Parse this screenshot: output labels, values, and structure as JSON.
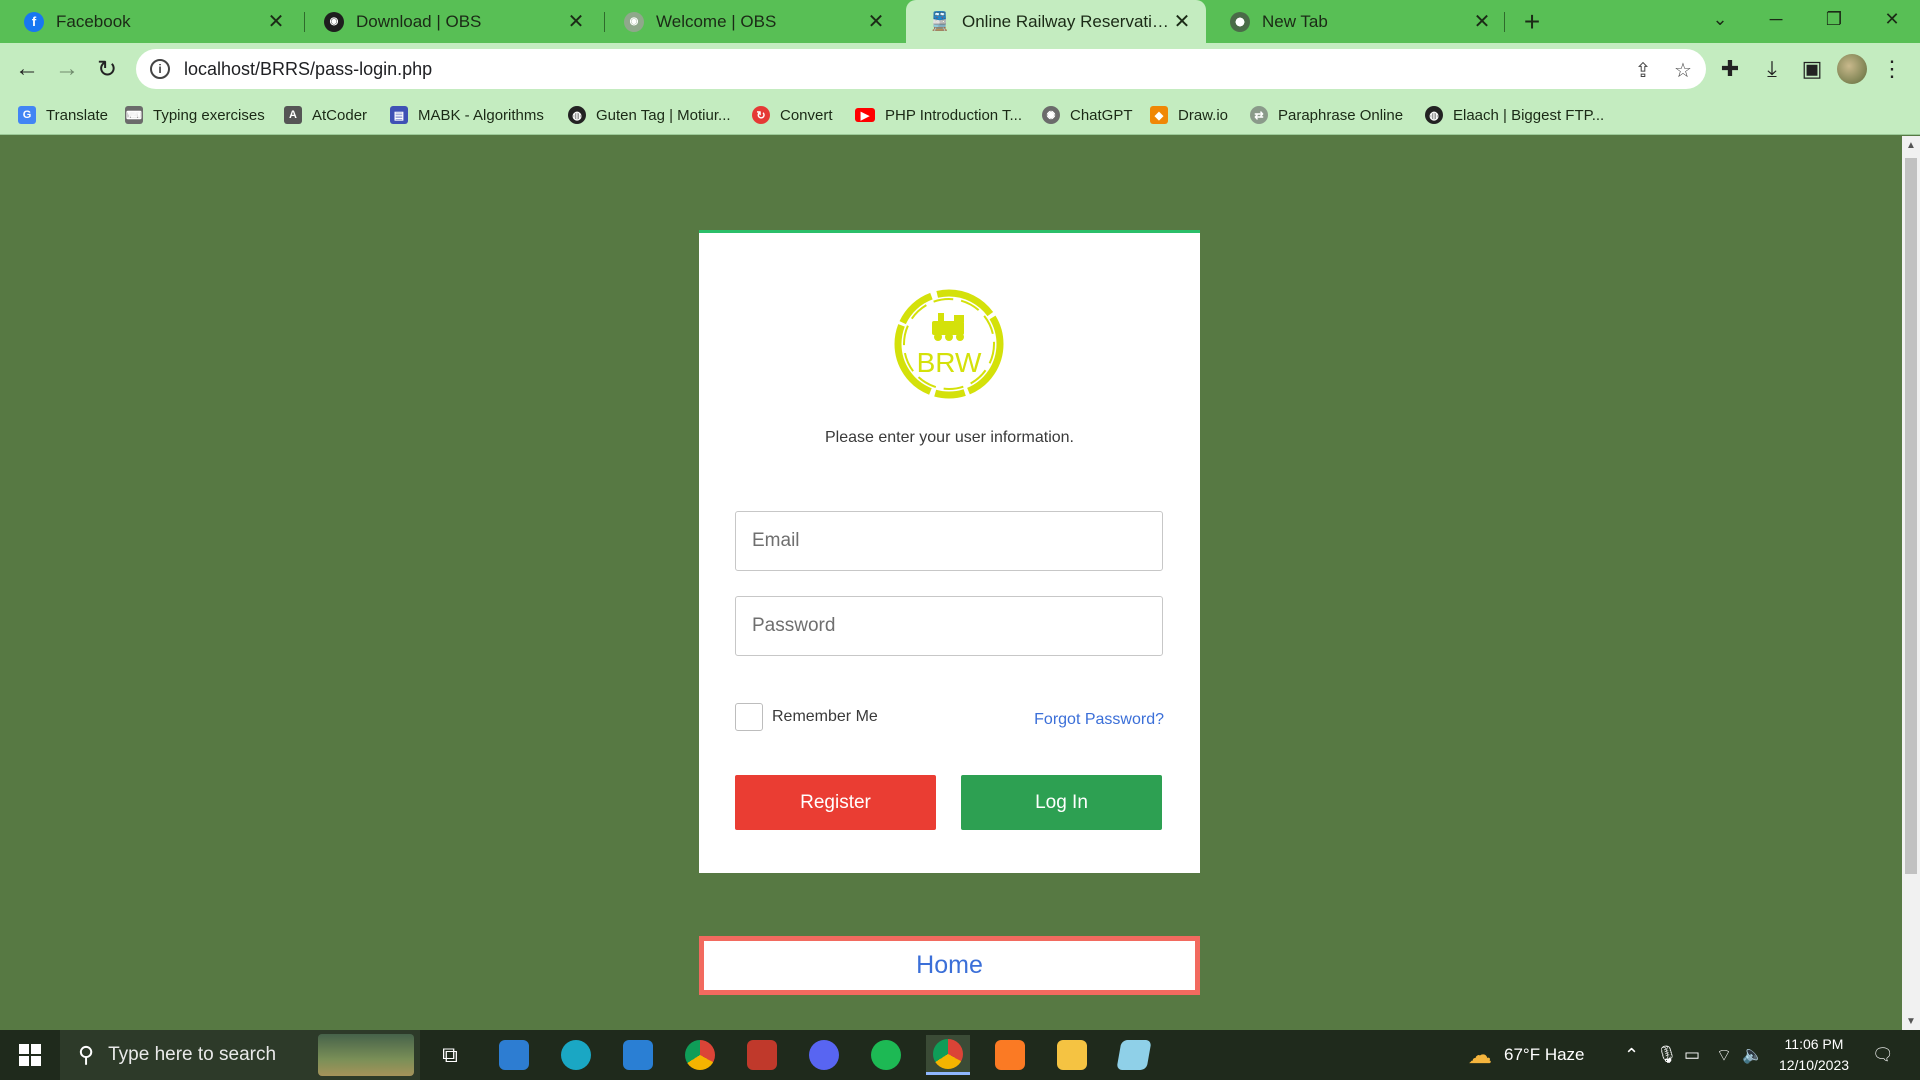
{
  "tabs": [
    {
      "title": "Facebook",
      "icon": "facebook-icon"
    },
    {
      "title": "Download | OBS",
      "icon": "obs-icon"
    },
    {
      "title": "Welcome | OBS",
      "icon": "obs-icon"
    },
    {
      "title": "Online Railway Reservation Syste",
      "icon": "train-icon"
    },
    {
      "title": "New Tab",
      "icon": "chrome-icon"
    }
  ],
  "address_bar": {
    "url": "localhost/BRRS/pass-login.php"
  },
  "bookmarks": [
    {
      "label": "Translate",
      "icon": "google-translate-icon",
      "color": "#4285f4"
    },
    {
      "label": "Typing exercises",
      "icon": "keyboard-icon",
      "color": "#6b6b6b"
    },
    {
      "label": "AtCoder",
      "icon": "atcoder-icon",
      "color": "#555555"
    },
    {
      "label": "MABK - Algorithms",
      "icon": "blog-icon",
      "color": "#3f51b5"
    },
    {
      "label": "Guten Tag | Motiur...",
      "icon": "globe-icon",
      "color": "#222222"
    },
    {
      "label": "Convert",
      "icon": "convert-icon",
      "color": "#e53935"
    },
    {
      "label": "PHP Introduction T...",
      "icon": "youtube-icon",
      "color": "#ff0000"
    },
    {
      "label": "ChatGPT",
      "icon": "chatgpt-icon",
      "color": "#6b6b6b"
    },
    {
      "label": "Draw.io",
      "icon": "drawio-icon",
      "color": "#f08705"
    },
    {
      "label": "Paraphrase Online",
      "icon": "paraphrase-icon",
      "color": "#8a9a8a"
    },
    {
      "label": "Elaach | Biggest FTP...",
      "icon": "globe-icon",
      "color": "#222222"
    }
  ],
  "login": {
    "logo_text": "BRW",
    "hint": "Please enter your user information.",
    "email_placeholder": "Email",
    "password_placeholder": "Password",
    "remember_label": "Remember Me",
    "forgot_label": "Forgot Password?",
    "register_label": "Register",
    "login_label": "Log In"
  },
  "home_link": "Home",
  "taskbar": {
    "search_placeholder": "Type here to search",
    "weather": "67°F  Haze",
    "time": "11:06 PM",
    "date": "12/10/2023"
  },
  "colors": {
    "page_bg": "#577943",
    "tab_bar": "#58bf55",
    "register": "#ea3d33",
    "login": "#2da052",
    "logo": "#d4e10a",
    "link": "#3b6fd8",
    "home_border": "#f26a5f"
  }
}
